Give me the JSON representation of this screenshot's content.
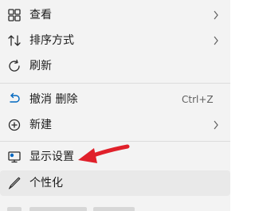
{
  "menu": {
    "items": [
      {
        "label": "查看",
        "icon": "view-icon",
        "submenu": true
      },
      {
        "label": "排序方式",
        "icon": "sort-icon",
        "submenu": true
      },
      {
        "label": "刷新",
        "icon": "refresh-icon",
        "submenu": false
      },
      {
        "label": "撤消 删除",
        "icon": "undo-icon",
        "shortcut": "Ctrl+Z",
        "submenu": false
      },
      {
        "label": "新建",
        "icon": "new-icon",
        "submenu": true
      },
      {
        "label": "显示设置",
        "icon": "display-settings-icon",
        "submenu": false
      },
      {
        "label": "个性化",
        "icon": "personalize-icon",
        "submenu": false
      }
    ],
    "highlighted_item": "个性化"
  },
  "annotation": {
    "arrow_color": "#e0202a"
  },
  "colors": {
    "menu_bg": "#f3f3f3",
    "hover_bg": "#e9e9e9",
    "accent": "#0067c0",
    "text": "#1b1b1b",
    "subtext": "#5f5f5f"
  }
}
